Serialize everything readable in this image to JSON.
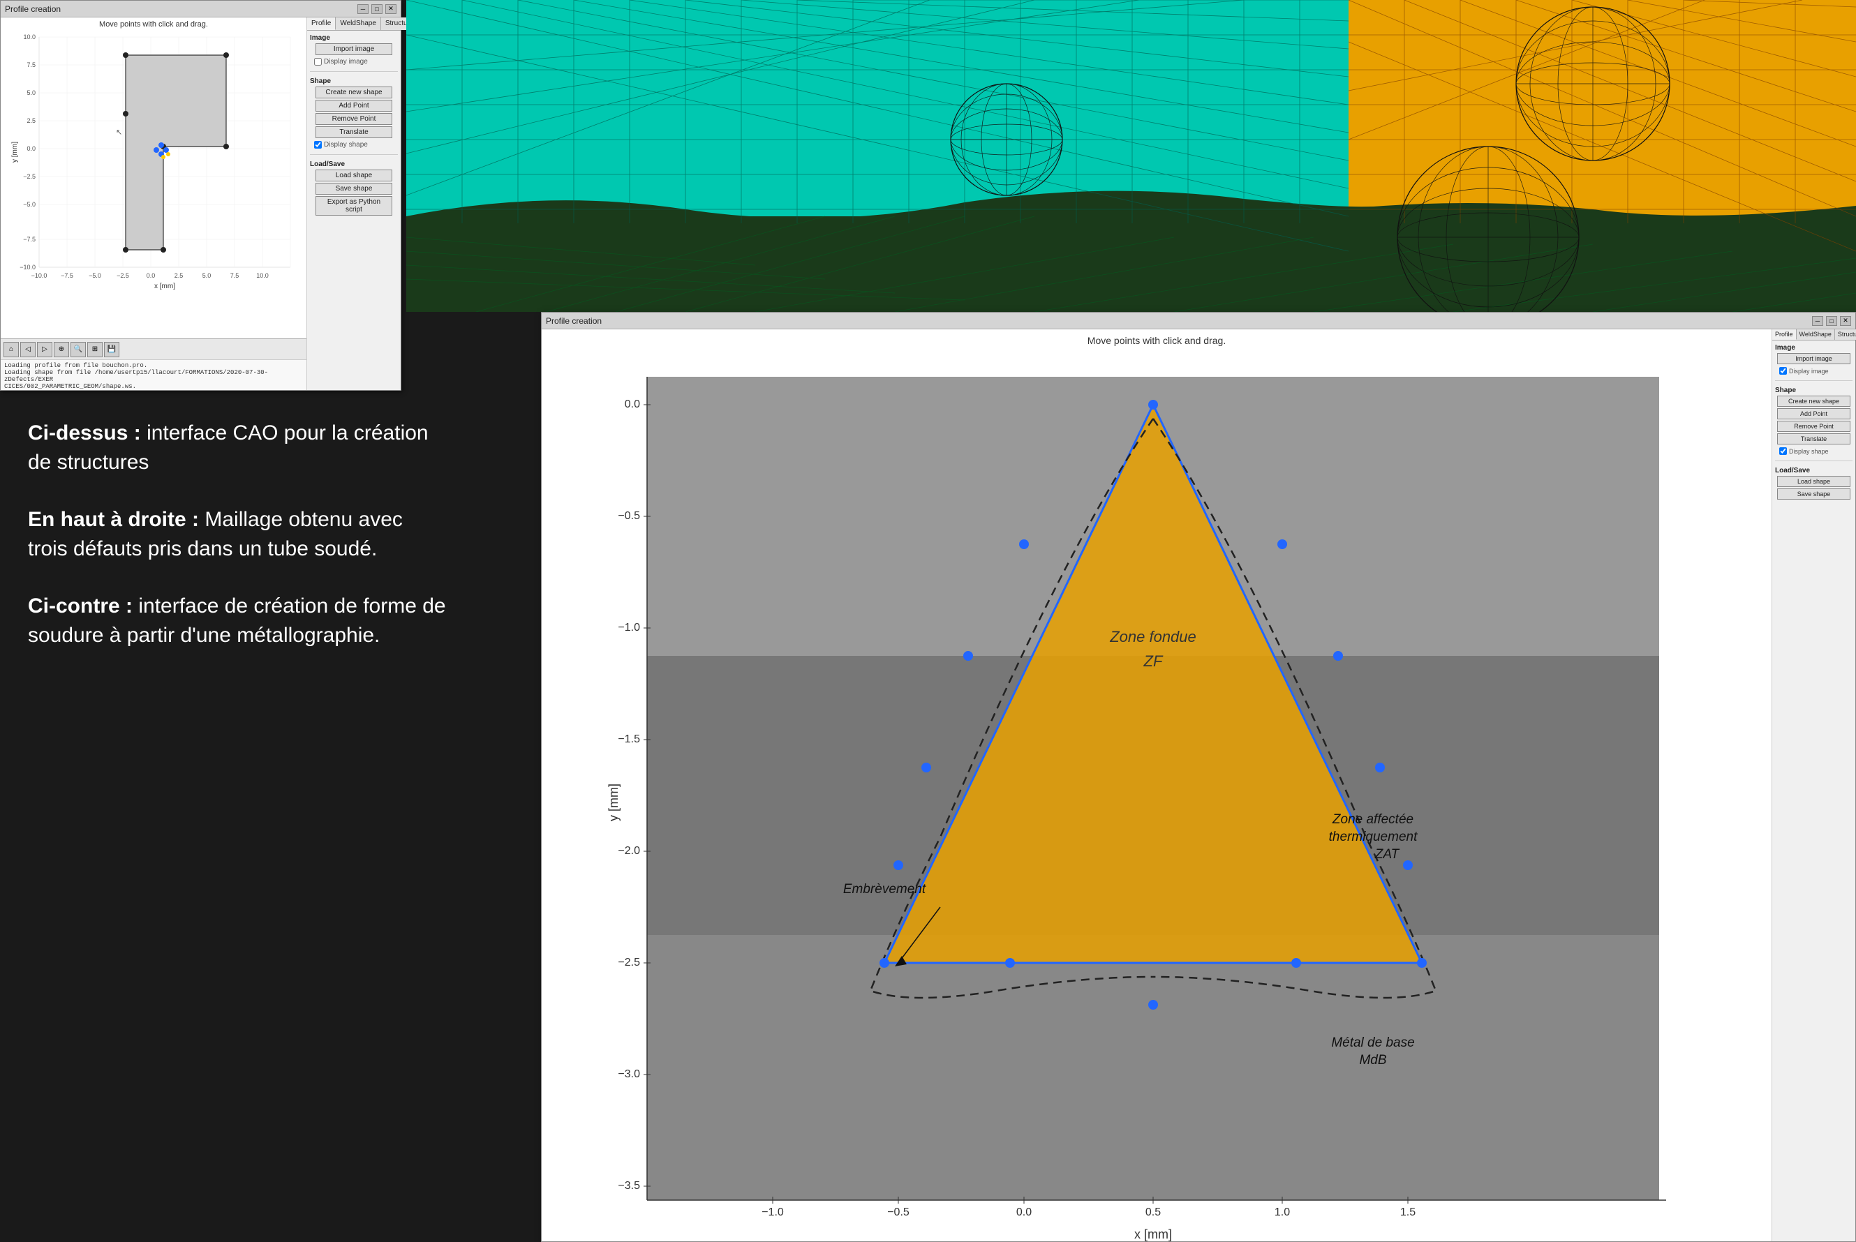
{
  "window1": {
    "title": "Profile creation",
    "canvas_title": "Move points with click and drag.",
    "tabs": [
      "Profile",
      "WeldShape",
      "Structure"
    ],
    "active_tab": "Profile",
    "image_section": "Image",
    "import_image_btn": "Import image",
    "display_image_label": "Display image",
    "shape_section": "Shape",
    "create_new_shape_btn": "Create new shape",
    "add_point_btn": "Add Point",
    "remove_point_btn": "Remove Point",
    "translate_btn": "Translate",
    "display_shape_label": "Display shape",
    "load_save_section": "Load/Save",
    "load_shape_btn": "Load shape",
    "save_shape_btn": "Save shape",
    "export_python_btn": "Export as Python script",
    "log_line1": "Loading profile from file bouchon.pro.",
    "log_line2": "Loading shape from file /home/usertp15/llacourt/FORMATIONS/2020-07-30-zDefects/EXER",
    "log_line3": "CICES/002_PARAMETRIC_GEOM/shape.ws.",
    "x_label": "x [mm]",
    "y_label": "y [mm]"
  },
  "window2": {
    "title": "Profile creation",
    "canvas_title": "Move points with click and drag.",
    "tabs": [
      "Profile",
      "WeldShape",
      "Structure"
    ],
    "active_tab": "Profile",
    "image_section": "Image",
    "import_image_btn": "Import image",
    "display_image_label": "Display image",
    "shape_section": "Shape",
    "create_new_shape_btn": "Create new shape",
    "add_point_btn": "Add Point",
    "remove_point_btn": "Remove Point",
    "translate_btn": "Translate",
    "display_shape_label": "Display shape",
    "load_save_section": "Load/Save",
    "load_shape_btn": "Load shape",
    "save_shape_btn": "Save shape",
    "x_label": "x [mm]",
    "y_label": "y [mm]"
  },
  "text": {
    "label1_bold": "Ci-dessus :",
    "label1_normal": "   interface CAO pour la création de structures",
    "label2_bold": "En haut à droite :",
    "label2_normal": "   Maillage obtenu avec trois défauts pris dans un tube soudé.",
    "label3_bold": "Ci-contre :",
    "label3_normal": "   interface de création de forme de soudure à partir d'une métallographie."
  },
  "weld_labels": {
    "zone_fondue": "Zone fondue",
    "zf": "ZF",
    "zone_affectee": "Zone affectée",
    "thermiquement": "thermiquement",
    "zat": "ZAT",
    "embrevement": "Embrèvement",
    "metal_base": "Métal de base",
    "mdb": "MdB"
  }
}
